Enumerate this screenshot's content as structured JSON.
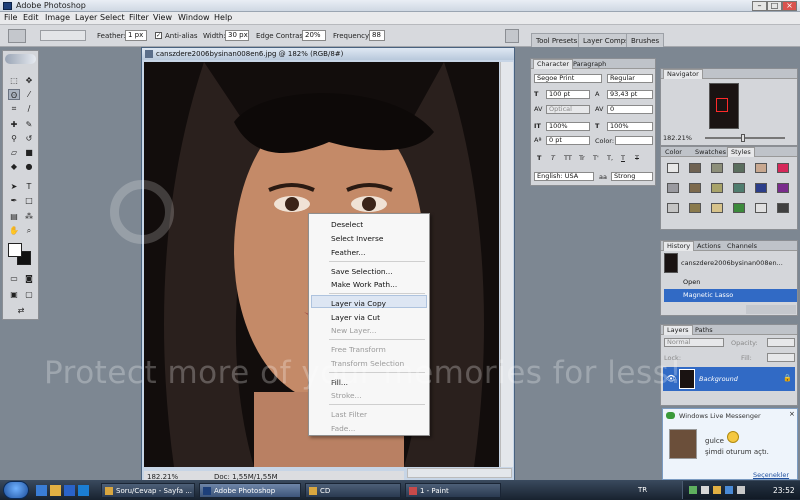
{
  "app": {
    "title": "Adobe Photoshop",
    "menu": [
      "File",
      "Edit",
      "Image",
      "Layer",
      "Select",
      "Filter",
      "View",
      "Window",
      "Help"
    ]
  },
  "options_bar": {
    "feather_label": "Feather:",
    "feather_value": "1 px",
    "antialias_label": "Anti-alias",
    "width_label": "Width:",
    "width_value": "30 px",
    "edge_label": "Edge Contrast:",
    "edge_value": "20%",
    "freq_label": "Frequency:",
    "freq_value": "88",
    "palette_tabs": [
      "Tool Presets",
      "Layer Comps",
      "Brushes"
    ]
  },
  "document": {
    "title": "canszdere2006bysinan008en6.jpg @ 182% (RGB/8#)",
    "zoom": "182.21%",
    "doc_size": "Doc: 1,55M/1,55M"
  },
  "context_menu": {
    "groups": [
      [
        {
          "label": "Deselect",
          "enabled": true
        },
        {
          "label": "Select Inverse",
          "enabled": true
        },
        {
          "label": "Feather...",
          "enabled": true
        }
      ],
      [
        {
          "label": "Save Selection...",
          "enabled": true
        },
        {
          "label": "Make Work Path...",
          "enabled": true
        }
      ],
      [
        {
          "label": "Layer via Copy",
          "enabled": true,
          "highlight": true
        },
        {
          "label": "Layer via Cut",
          "enabled": true
        },
        {
          "label": "New Layer...",
          "enabled": false
        }
      ],
      [
        {
          "label": "Free Transform",
          "enabled": false
        },
        {
          "label": "Transform Selection",
          "enabled": false
        }
      ],
      [
        {
          "label": "Fill...",
          "enabled": true
        },
        {
          "label": "Stroke...",
          "enabled": false
        }
      ],
      [
        {
          "label": "Last Filter",
          "enabled": false
        },
        {
          "label": "Fade...",
          "enabled": false
        }
      ]
    ]
  },
  "character_panel": {
    "tabs": [
      "Character",
      "Paragraph"
    ],
    "font_family": "Segoe Print",
    "font_style": "Regular",
    "size": "100 pt",
    "leading": "93,43 pt",
    "kerning": "Optical",
    "tracking": "0",
    "vscale": "100%",
    "hscale": "100%",
    "baseline": "0 pt",
    "color_label": "Color:",
    "language": "English: USA",
    "aa_label": "aa",
    "antialias": "Strong",
    "style_buttons": [
      "T",
      "T",
      "TT",
      "Tr",
      "T'",
      "T,",
      "T",
      "T"
    ]
  },
  "navigator": {
    "title": "Navigator",
    "zoom": "182.21%"
  },
  "styles_panel": {
    "tabs": [
      "Color",
      "Swatches",
      "Styles"
    ],
    "swatches": [
      "#e8e8e8",
      "#6f6252",
      "#8d8f7a",
      "#5a6e5e",
      "#c8a890",
      "#d6285a",
      "#9a9aa0",
      "#7d6a4d",
      "#a8a36a",
      "#4f7d6f",
      "#2c3e8a",
      "#7a2c8c",
      "#c4c4c4",
      "#8a7a4c",
      "#d6c28a",
      "#3c8a3c",
      "#e0e0e0",
      "#404040"
    ]
  },
  "history_panel": {
    "tabs": [
      "History",
      "Actions",
      "Channels"
    ],
    "snapshot": "canszdere2006bysinan008en...",
    "items": [
      {
        "label": "Open",
        "selected": false
      },
      {
        "label": "Magnetic Lasso",
        "selected": true
      }
    ]
  },
  "layers_panel": {
    "tabs": [
      "Layers",
      "Paths"
    ],
    "blend": "Normal",
    "opacity_label": "Opacity:",
    "lock_label": "Lock:",
    "fill_label": "Fill:",
    "layer_name": "Background"
  },
  "messenger": {
    "title": "Windows Live Messenger",
    "user": "gulce",
    "status_text": "şimdi oturum açtı.",
    "options": "Seçenekler"
  },
  "taskbar": {
    "buttons": [
      {
        "label": "Soru/Cevap - Sayfa ...",
        "active": false
      },
      {
        "label": "Adobe Photoshop",
        "active": true
      },
      {
        "label": "CD",
        "active": false
      },
      {
        "label": "1 - Paint",
        "active": false
      }
    ],
    "lang": "TR",
    "clock": "23:52"
  },
  "watermark": {
    "text": "Protect more of your memories for less!"
  }
}
